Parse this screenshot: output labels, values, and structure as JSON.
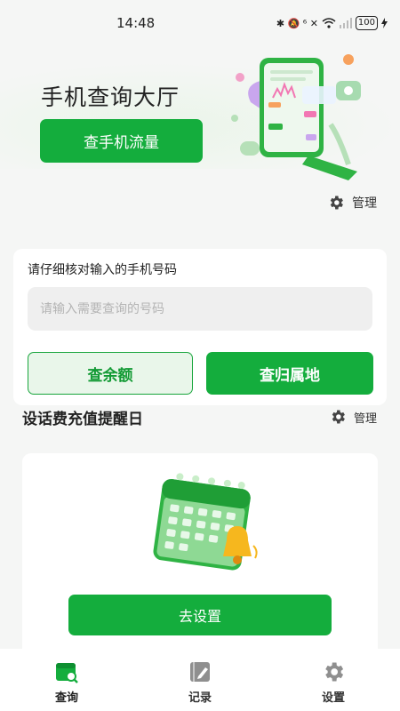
{
  "status_bar": {
    "time": "14:48",
    "signal_indicators": "✱ 🔕 ⁶ ✕",
    "battery": "100"
  },
  "hero": {
    "title": "手机查询大厅",
    "flow_button": "查手机流量"
  },
  "manage_top": {
    "label": "管理"
  },
  "query_card": {
    "label": "请仔细核对输入的手机号码",
    "input_placeholder": "请输入需要查询的号码",
    "input_value": "",
    "balance_button": "查余额",
    "area_button": "查归属地"
  },
  "reminder": {
    "title": "设话费充值提醒日",
    "manage_label": "管理",
    "set_button": "去设置"
  },
  "tabs": [
    {
      "label": "查询",
      "icon": "calendar-search-icon",
      "active": true
    },
    {
      "label": "记录",
      "icon": "notebook-pen-icon",
      "active": false
    },
    {
      "label": "设置",
      "icon": "gear-icon",
      "active": false
    }
  ],
  "colors": {
    "primary": "#14ad3d",
    "primary_light": "#e9f6ea",
    "background": "#f5f6f5",
    "tab_icon": "#8f8f8f"
  }
}
